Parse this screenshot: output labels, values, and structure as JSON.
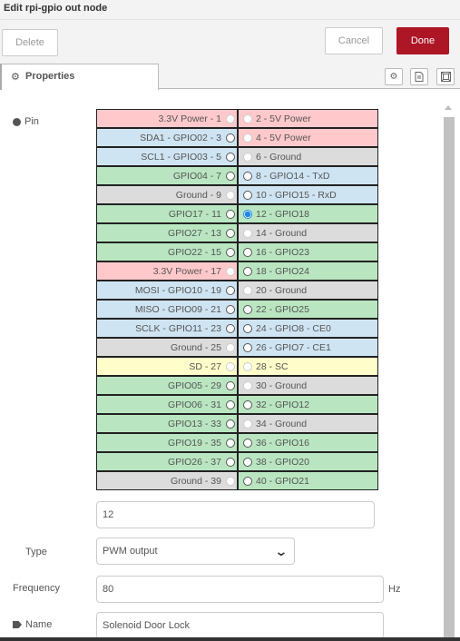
{
  "window": {
    "title": "Edit rpi-gpio out node"
  },
  "toolbar": {
    "delete_label": "Delete",
    "cancel_label": "Cancel",
    "done_label": "Done"
  },
  "tabs": {
    "properties_label": "Properties",
    "properties_icon": "gear-icon",
    "action_icons": [
      "settings-gear-icon",
      "description-doc-icon",
      "appearance-layout-icon"
    ]
  },
  "form": {
    "pin_label": "Pin",
    "pin_value": "12",
    "type_label": "Type",
    "type_value": "PWM output",
    "frequency_label": "Frequency",
    "frequency_value": "80",
    "frequency_unit": "Hz",
    "name_label": "Name",
    "name_value": "Solenoid Door Lock"
  },
  "pins": [
    {
      "left": "3.3V Power - 1",
      "left_type": "power",
      "left_selectable": false,
      "right": "2 - 5V Power",
      "right_type": "power",
      "right_selectable": false
    },
    {
      "left": "SDA1 - GPIO02 - 3",
      "left_type": "i2c",
      "left_selectable": true,
      "right": "4 - 5V Power",
      "right_type": "power",
      "right_selectable": false
    },
    {
      "left": "SCL1 - GPIO03 - 5",
      "left_type": "i2c",
      "left_selectable": true,
      "right": "6 - Ground",
      "right_type": "ground",
      "right_selectable": false
    },
    {
      "left": "GPIO04 - 7",
      "left_type": "gpio",
      "left_selectable": true,
      "right": "8 - GPIO14 - TxD",
      "right_type": "i2c",
      "right_selectable": true
    },
    {
      "left": "Ground - 9",
      "left_type": "ground",
      "left_selectable": false,
      "right": "10 - GPIO15 - RxD",
      "right_type": "i2c",
      "right_selectable": true
    },
    {
      "left": "GPIO17 - 11",
      "left_type": "gpio",
      "left_selectable": true,
      "right": "12 - GPIO18",
      "right_type": "gpio",
      "right_selectable": true,
      "right_checked": true
    },
    {
      "left": "GPIO27 - 13",
      "left_type": "gpio",
      "left_selectable": true,
      "right": "14 - Ground",
      "right_type": "ground",
      "right_selectable": false
    },
    {
      "left": "GPIO22 - 15",
      "left_type": "gpio",
      "left_selectable": true,
      "right": "16 - GPIO23",
      "right_type": "gpio",
      "right_selectable": true
    },
    {
      "left": "3.3V Power - 17",
      "left_type": "power",
      "left_selectable": false,
      "right": "18 - GPIO24",
      "right_type": "gpio",
      "right_selectable": true
    },
    {
      "left": "MOSI - GPIO10 - 19",
      "left_type": "i2c",
      "left_selectable": true,
      "right": "20 - Ground",
      "right_type": "ground",
      "right_selectable": false
    },
    {
      "left": "MISO - GPIO09 - 21",
      "left_type": "i2c",
      "left_selectable": true,
      "right": "22 - GPIO25",
      "right_type": "gpio",
      "right_selectable": true
    },
    {
      "left": "SCLK - GPIO11 - 23",
      "left_type": "i2c",
      "left_selectable": true,
      "right": "24 - GPIO8 - CE0",
      "right_type": "i2c",
      "right_selectable": true
    },
    {
      "left": "Ground - 25",
      "left_type": "ground",
      "left_selectable": false,
      "right": "26 - GPIO7 - CE1",
      "right_type": "i2c",
      "right_selectable": true
    },
    {
      "left": "SD - 27",
      "left_type": "sd",
      "left_selectable": false,
      "right": "28 - SC",
      "right_type": "sd",
      "right_selectable": false
    },
    {
      "left": "GPIO05 - 29",
      "left_type": "gpio",
      "left_selectable": true,
      "right": "30 - Ground",
      "right_type": "ground",
      "right_selectable": false
    },
    {
      "left": "GPIO06 - 31",
      "left_type": "gpio",
      "left_selectable": true,
      "right": "32 - GPIO12",
      "right_type": "gpio",
      "right_selectable": true
    },
    {
      "left": "GPIO13 - 33",
      "left_type": "gpio",
      "left_selectable": true,
      "right": "34 - Ground",
      "right_type": "ground",
      "right_selectable": false
    },
    {
      "left": "GPIO19 - 35",
      "left_type": "gpio",
      "left_selectable": true,
      "right": "36 - GPIO16",
      "right_type": "gpio",
      "right_selectable": true
    },
    {
      "left": "GPIO26 - 37",
      "left_type": "gpio",
      "left_selectable": true,
      "right": "38 - GPIO20",
      "right_type": "gpio",
      "right_selectable": true
    },
    {
      "left": "Ground - 39",
      "left_type": "ground",
      "left_selectable": false,
      "right": "40 - GPIO21",
      "right_type": "gpio",
      "right_selectable": true
    }
  ],
  "colors": {
    "power": "#ffc9cc",
    "i2c": "#cfe4f2",
    "gpio": "#b9e6c1",
    "ground": "#dcdcdc",
    "sd": "#fffdc9",
    "done_button": "#ad1625"
  }
}
